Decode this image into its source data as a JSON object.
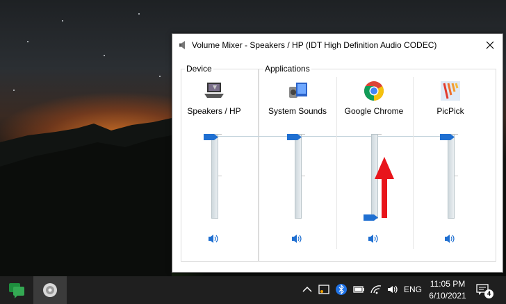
{
  "window": {
    "title": "Volume Mixer - Speakers / HP (IDT High Definition Audio CODEC)",
    "close_icon": "close-icon"
  },
  "device_group": {
    "label": "Device",
    "channel": {
      "name": "Speakers / HP",
      "icon": "speaker-device-icon",
      "level": 1.0
    }
  },
  "applications_group": {
    "label": "Applications",
    "channels": [
      {
        "name": "System Sounds",
        "icon": "system-sounds-icon",
        "level": 1.0
      },
      {
        "name": "Google Chrome",
        "icon": "chrome-icon",
        "level": 0.0
      },
      {
        "name": "PicPick",
        "icon": "picpick-icon",
        "level": 1.0
      }
    ]
  },
  "annotation": {
    "icon": "red-arrow-up-icon"
  },
  "taskbar": {
    "apps": [
      "google-chat-icon",
      "volume-mixer-taskbar-icon"
    ],
    "tray": {
      "language": "ENG",
      "time": "11:05 PM",
      "date": "6/10/2021",
      "notification_count": "4"
    }
  }
}
